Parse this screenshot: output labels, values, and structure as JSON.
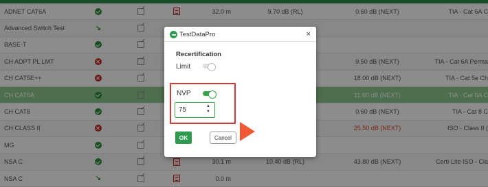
{
  "table": {
    "rows": [
      {
        "name": "ADNET CAT6A",
        "status": "pass",
        "length": "32.0 m",
        "loss": "9.70 dB (RL)",
        "next": "0.60 dB (NEXT)",
        "next_red": false,
        "standard": "TIA - Cat 6A C",
        "has_doc": true
      },
      {
        "name": "Advanced Switch Test",
        "status": "partial",
        "length": "",
        "loss": "",
        "next": "",
        "next_red": false,
        "standard": "",
        "has_doc": false
      },
      {
        "name": "BASE-T",
        "status": "pass",
        "length": "",
        "loss": "",
        "next": "",
        "next_red": false,
        "standard": "",
        "has_doc": false
      },
      {
        "name": "CH ADPT PL LMT",
        "status": "fail",
        "length": "",
        "loss": "",
        "next": "9.50 dB (NEXT)",
        "next_red": false,
        "standard": "TIA - Cat 6A Perma",
        "has_doc": false
      },
      {
        "name": "CH CAT5E++",
        "status": "fail",
        "length": "",
        "loss": "",
        "next": "18.00 dB (NEXT)",
        "next_red": false,
        "standard": "TIA - Cat 5e Ch",
        "has_doc": false
      },
      {
        "name": "CH CAT6A",
        "status": "pass",
        "length": "",
        "loss": "",
        "next": "11.60 dB (NEXT)",
        "next_red": false,
        "standard": "TIA - Cat 6A C",
        "has_doc": false,
        "highlight": true
      },
      {
        "name": "CH CAT8",
        "status": "pass",
        "length": "",
        "loss": "",
        "next": "0.60 dB (NEXT)",
        "next_red": false,
        "standard": "TIA - Cat 8 C",
        "has_doc": false
      },
      {
        "name": "CH CLASS II",
        "status": "fail",
        "length": "",
        "loss": "",
        "next": "25.50 dB (NEXT)",
        "next_red": true,
        "standard": "ISO - Class II (",
        "has_doc": false
      },
      {
        "name": "MG",
        "status": "pass",
        "length": "",
        "loss": "",
        "next": "",
        "next_red": false,
        "standard": "",
        "has_doc": false
      },
      {
        "name": "NSA C",
        "status": "pass",
        "length": "30.1 m",
        "loss": "10.40 dB (RL)",
        "next": "43.80 dB (NEXT)",
        "next_red": false,
        "standard": "Certi-Lite ISO - Cla",
        "has_doc": true
      },
      {
        "name": "NSA C",
        "status": "partial",
        "length": "0.0 m",
        "loss": "",
        "next": "",
        "next_red": false,
        "standard": "",
        "has_doc": true
      }
    ]
  },
  "dialog": {
    "title": "TestDataPro",
    "close": "×",
    "section_heading": "Recertification",
    "limit_label": "Limit",
    "limit_enabled": false,
    "nvp_label": "NVP",
    "nvp_enabled": true,
    "nvp_value": "75",
    "ok_label": "OK",
    "cancel_label": "Cancel"
  },
  "colors": {
    "accent_green": "#2f9a4f",
    "highlight_red": "#d23a3a",
    "pointer_orange": "#ee5a36"
  },
  "icons": {
    "app": "app-logo-icon",
    "close": "close-icon",
    "pass": "check-circle-icon",
    "fail": "x-circle-icon",
    "edit": "edit-icon",
    "doc": "pdf-icon",
    "pointer": "arrow-pointer-icon"
  }
}
